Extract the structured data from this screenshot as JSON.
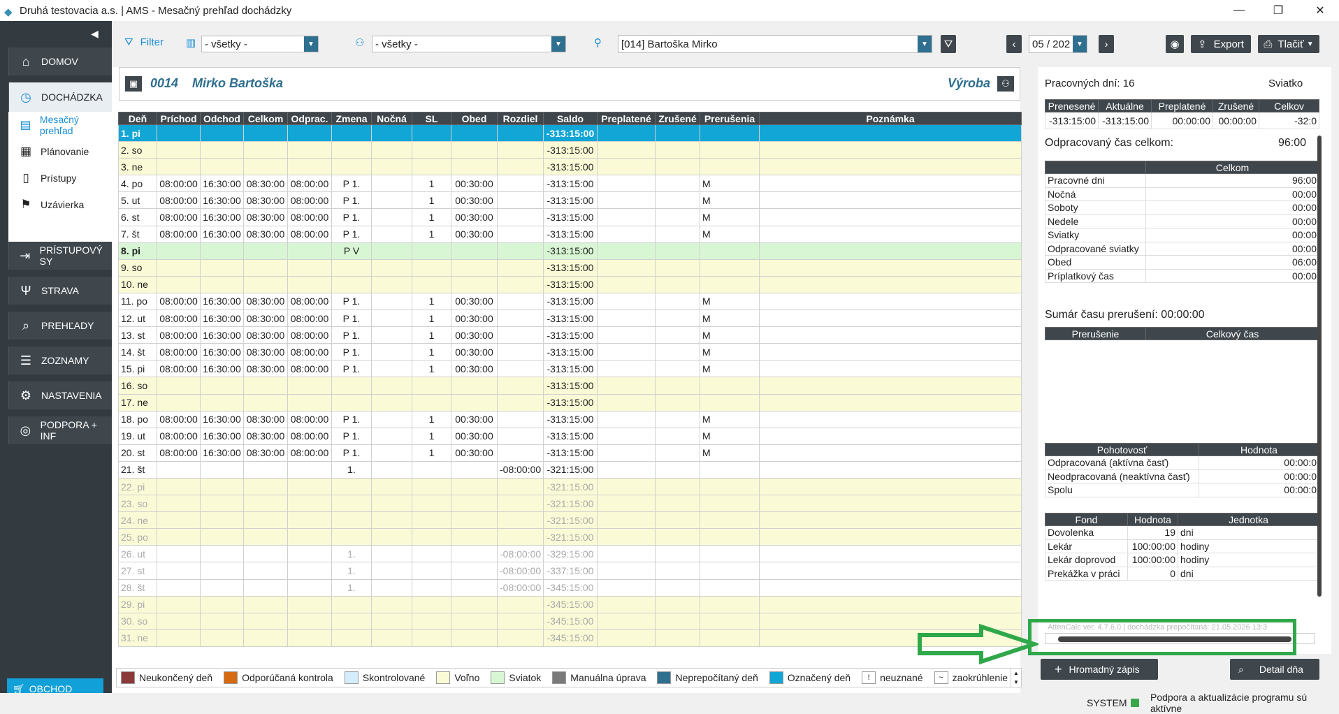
{
  "window": {
    "title": "Druhá testovacia a.s. | AMS - Mesačný prehľad dochádzky",
    "min": "—",
    "max": "❐",
    "close": "✕"
  },
  "sidebar": {
    "items": [
      {
        "label": "DOMOV",
        "icon": "home-icon"
      },
      {
        "label": "DOCHÁDZKA",
        "icon": "clock-icon"
      },
      {
        "label": "PRÍSTUPOVÝ SY",
        "icon": "login-icon"
      },
      {
        "label": "STRAVA",
        "icon": "utensils-icon"
      },
      {
        "label": "PREHĽADY",
        "icon": "search-icon"
      },
      {
        "label": "ZOZNAMY",
        "icon": "list-icon"
      },
      {
        "label": "NASTAVENIA",
        "icon": "gear-icon"
      },
      {
        "label": "PODPORA + INF",
        "icon": "lifebuoy-icon"
      }
    ],
    "sub": [
      "Mesačný prehľad",
      "Plánovanie",
      "Prístupy",
      "Uzávierka"
    ],
    "shop": "OBCHOD"
  },
  "toolbar": {
    "filter": "Filter",
    "select1": "- všetky -",
    "select2": "- všetky -",
    "employee": "[014] Bartoška Mirko",
    "month": "05 / 202",
    "export": "Export",
    "print": "Tlačiť"
  },
  "employee": {
    "id": "0014",
    "name": "Mirko Bartoška",
    "dept": "Výroba"
  },
  "table": {
    "headers": [
      "Deň",
      "Príchod",
      "Odchod",
      "Celkom",
      "Odprac.",
      "Zmena",
      "Nočná",
      "SL",
      "Obed",
      "Rozdiel",
      "Saldo",
      "Preplatené",
      "Zrušené",
      "Prerušenia",
      "Poznámka"
    ],
    "rows": [
      [
        "1. pi",
        "",
        "",
        "",
        "",
        "",
        "",
        "",
        "",
        "",
        "-313:15:00",
        "",
        "",
        "",
        ""
      ],
      [
        "2. so",
        "",
        "",
        "",
        "",
        "",
        "",
        "",
        "",
        "",
        "-313:15:00",
        "",
        "",
        "",
        ""
      ],
      [
        "3. ne",
        "",
        "",
        "",
        "",
        "",
        "",
        "",
        "",
        "",
        "-313:15:00",
        "",
        "",
        "",
        ""
      ],
      [
        "4. po",
        "08:00:00",
        "16:30:00",
        "08:30:00",
        "08:00:00",
        "P 1.",
        "",
        "1",
        "00:30:00",
        "",
        "-313:15:00",
        "",
        "",
        "M",
        ""
      ],
      [
        "5. ut",
        "08:00:00",
        "16:30:00",
        "08:30:00",
        "08:00:00",
        "P 1.",
        "",
        "1",
        "00:30:00",
        "",
        "-313:15:00",
        "",
        "",
        "M",
        ""
      ],
      [
        "6. st",
        "08:00:00",
        "16:30:00",
        "08:30:00",
        "08:00:00",
        "P 1.",
        "",
        "1",
        "00:30:00",
        "",
        "-313:15:00",
        "",
        "",
        "M",
        ""
      ],
      [
        "7. št",
        "08:00:00",
        "16:30:00",
        "08:30:00",
        "08:00:00",
        "P 1.",
        "",
        "1",
        "00:30:00",
        "",
        "-313:15:00",
        "",
        "",
        "M",
        ""
      ],
      [
        "8. pi",
        "",
        "",
        "",
        "",
        "P V",
        "",
        "",
        "",
        "",
        "-313:15:00",
        "",
        "",
        "",
        ""
      ],
      [
        "9. so",
        "",
        "",
        "",
        "",
        "",
        "",
        "",
        "",
        "",
        "-313:15:00",
        "",
        "",
        "",
        ""
      ],
      [
        "10. ne",
        "",
        "",
        "",
        "",
        "",
        "",
        "",
        "",
        "",
        "-313:15:00",
        "",
        "",
        "",
        ""
      ],
      [
        "11. po",
        "08:00:00",
        "16:30:00",
        "08:30:00",
        "08:00:00",
        "P 1.",
        "",
        "1",
        "00:30:00",
        "",
        "-313:15:00",
        "",
        "",
        "M",
        ""
      ],
      [
        "12. ut",
        "08:00:00",
        "16:30:00",
        "08:30:00",
        "08:00:00",
        "P 1.",
        "",
        "1",
        "00:30:00",
        "",
        "-313:15:00",
        "",
        "",
        "M",
        ""
      ],
      [
        "13. st",
        "08:00:00",
        "16:30:00",
        "08:30:00",
        "08:00:00",
        "P 1.",
        "",
        "1",
        "00:30:00",
        "",
        "-313:15:00",
        "",
        "",
        "M",
        ""
      ],
      [
        "14. št",
        "08:00:00",
        "16:30:00",
        "08:30:00",
        "08:00:00",
        "P 1.",
        "",
        "1",
        "00:30:00",
        "",
        "-313:15:00",
        "",
        "",
        "M",
        ""
      ],
      [
        "15. pi",
        "08:00:00",
        "16:30:00",
        "08:30:00",
        "08:00:00",
        "P 1.",
        "",
        "1",
        "00:30:00",
        "",
        "-313:15:00",
        "",
        "",
        "M",
        ""
      ],
      [
        "16. so",
        "",
        "",
        "",
        "",
        "",
        "",
        "",
        "",
        "",
        "-313:15:00",
        "",
        "",
        "",
        ""
      ],
      [
        "17. ne",
        "",
        "",
        "",
        "",
        "",
        "",
        "",
        "",
        "",
        "-313:15:00",
        "",
        "",
        "",
        ""
      ],
      [
        "18. po",
        "08:00:00",
        "16:30:00",
        "08:30:00",
        "08:00:00",
        "P 1.",
        "",
        "1",
        "00:30:00",
        "",
        "-313:15:00",
        "",
        "",
        "M",
        ""
      ],
      [
        "19. ut",
        "08:00:00",
        "16:30:00",
        "08:30:00",
        "08:00:00",
        "P 1.",
        "",
        "1",
        "00:30:00",
        "",
        "-313:15:00",
        "",
        "",
        "M",
        ""
      ],
      [
        "20. st",
        "08:00:00",
        "16:30:00",
        "08:30:00",
        "08:00:00",
        "P 1.",
        "",
        "1",
        "00:30:00",
        "",
        "-313:15:00",
        "",
        "",
        "M",
        ""
      ],
      [
        "21. št",
        "",
        "",
        "",
        "",
        "1.",
        "",
        "",
        "",
        "-08:00:00",
        "-321:15:00",
        "",
        "",
        "",
        ""
      ],
      [
        "22. pi",
        "",
        "",
        "",
        "",
        "",
        "",
        "",
        "",
        "",
        "-321:15:00",
        "",
        "",
        "",
        ""
      ],
      [
        "23. so",
        "",
        "",
        "",
        "",
        "",
        "",
        "",
        "",
        "",
        "-321:15:00",
        "",
        "",
        "",
        ""
      ],
      [
        "24. ne",
        "",
        "",
        "",
        "",
        "",
        "",
        "",
        "",
        "",
        "-321:15:00",
        "",
        "",
        "",
        ""
      ],
      [
        "25. po",
        "",
        "",
        "",
        "",
        "",
        "",
        "",
        "",
        "",
        "-321:15:00",
        "",
        "",
        "",
        ""
      ],
      [
        "26. ut",
        "",
        "",
        "",
        "",
        "1.",
        "",
        "",
        "",
        "-08:00:00",
        "-329:15:00",
        "",
        "",
        "",
        ""
      ],
      [
        "27. st",
        "",
        "",
        "",
        "",
        "1.",
        "",
        "",
        "",
        "-08:00:00",
        "-337:15:00",
        "",
        "",
        "",
        ""
      ],
      [
        "28. št",
        "",
        "",
        "",
        "",
        "1.",
        "",
        "",
        "",
        "-08:00:00",
        "-345:15:00",
        "",
        "",
        "",
        ""
      ],
      [
        "29. pi",
        "",
        "",
        "",
        "",
        "",
        "",
        "",
        "",
        "",
        "-345:15:00",
        "",
        "",
        "",
        ""
      ],
      [
        "30. so",
        "",
        "",
        "",
        "",
        "",
        "",
        "",
        "",
        "",
        "-345:15:00",
        "",
        "",
        "",
        ""
      ],
      [
        "31. ne",
        "",
        "",
        "",
        "",
        "",
        "",
        "",
        "",
        "",
        "-345:15:00",
        "",
        "",
        "",
        ""
      ]
    ],
    "rowTypes": [
      "sel",
      "wk",
      "wk",
      "n",
      "n",
      "n",
      "n",
      "gr",
      "wk",
      "wk",
      "n",
      "n",
      "n",
      "n",
      "n",
      "wk",
      "wk",
      "n",
      "n",
      "n",
      "n",
      "wkf",
      "wkf",
      "wkf",
      "wkf",
      "nf",
      "nf",
      "nf",
      "wkf",
      "wkf",
      "wkf"
    ]
  },
  "legend": [
    {
      "label": "Neukončený deň",
      "color": "#8b3a3a"
    },
    {
      "label": "Odporúčaná kontrola",
      "color": "#d66a12"
    },
    {
      "label": "Skontrolované",
      "color": "#d4ecfb"
    },
    {
      "label": "Voľno",
      "color": "#fafad6"
    },
    {
      "label": "Sviatok",
      "color": "#d8f6d4"
    },
    {
      "label": "Manuálna úprava",
      "color": "#7a7a7a"
    },
    {
      "label": "Neprepočítaný deň",
      "color": "#2f6f8f"
    },
    {
      "label": "Označený deň",
      "color": "#12a6d6"
    },
    {
      "label": "neuznané",
      "color": "#ffffff",
      "mark": "!"
    },
    {
      "label": "zaokrúhlenie",
      "color": "#ffffff",
      "mark": "~"
    }
  ],
  "right": {
    "workdays_label": "Pracovných dní: 16",
    "holidays_label": "Sviatko",
    "saldo_headers": [
      "Prenesené",
      "Aktuálne",
      "Preplatené",
      "Zrušené",
      "Celkov"
    ],
    "saldo_values": [
      "-313:15:00",
      "-313:15:00",
      "00:00:00",
      "00:00:00",
      "-32:0"
    ],
    "worked_label": "Odpracovaný čas celkom:",
    "worked_value": "96:00",
    "summary_header": "Celkom",
    "summary": [
      [
        "Pracovné dni",
        "96:00"
      ],
      [
        "Nočná",
        "00:00"
      ],
      [
        "Soboty",
        "00:00"
      ],
      [
        "Nedele",
        "00:00"
      ],
      [
        "Sviatky",
        "00:00"
      ],
      [
        "Odpracované sviatky",
        "00:00"
      ],
      [
        "Obed",
        "06:00"
      ],
      [
        "Príplatkový čas",
        "00:00"
      ]
    ],
    "interrupt_label": "Sumár času prerušení: 00:00:00",
    "interrupt_headers": [
      "Prerušenie",
      "Celkový čas"
    ],
    "standby_headers": [
      "Pohotovosť",
      "Hodnota"
    ],
    "standby": [
      [
        "Odpracovaná (aktívna časť)",
        "00:00:0"
      ],
      [
        "Neodpracovaná (neaktívna časť)",
        "00:00:0"
      ],
      [
        "Spolu",
        "00:00:0"
      ]
    ],
    "fund_headers": [
      "Fond",
      "Hodnota",
      "Jednotka"
    ],
    "fund": [
      [
        "Dovolenka",
        "19",
        "dni"
      ],
      [
        "Lekár",
        "100:00:00",
        "hodiny"
      ],
      [
        "Lekár doprovod",
        "100:00:00",
        "hodiny"
      ],
      [
        "Prekážka v práci",
        "0",
        "dni"
      ]
    ],
    "version": "AttenCalc ver. 4.7.6.0 | dochádzka prepočítaná: 21.05.2026 13:3"
  },
  "buttons": {
    "bulk": "Hromadný zápis",
    "detail": "Detail dňa"
  },
  "status": {
    "system": "SYSTEM",
    "message": "Podpora a aktualizácie programu sú aktívne"
  }
}
